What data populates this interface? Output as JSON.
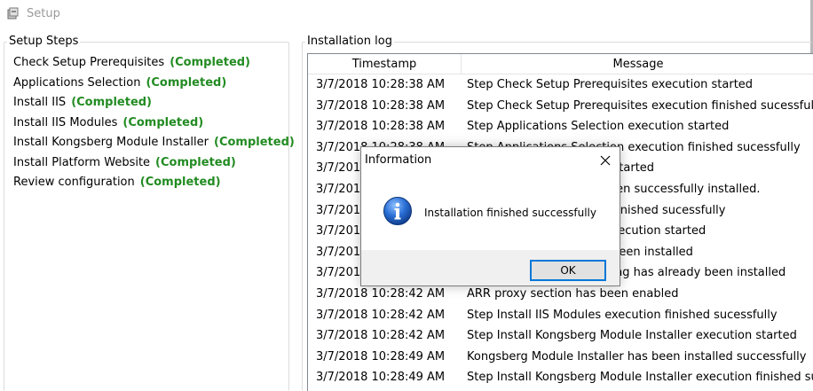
{
  "window": {
    "title": "Setup",
    "icon": "setup-app-icon"
  },
  "steps_panel": {
    "label": "Setup Steps",
    "items": [
      {
        "name": "Check Setup Prerequisites",
        "status": "(Completed)"
      },
      {
        "name": "Applications Selection",
        "status": "(Completed)"
      },
      {
        "name": "Install IIS",
        "status": "(Completed)"
      },
      {
        "name": "Install IIS Modules",
        "status": "(Completed)"
      },
      {
        "name": "Install Kongsberg Module Installer",
        "status": "(Completed)"
      },
      {
        "name": "Install Platform Website",
        "status": "(Completed)"
      },
      {
        "name": "Review configuration",
        "status": "(Completed)"
      }
    ],
    "status_color": "#228b22"
  },
  "log_panel": {
    "label": "Installation log",
    "columns": {
      "timestamp": "Timestamp",
      "message": "Message"
    },
    "rows": [
      {
        "timestamp": "3/7/2018 10:28:38 AM",
        "message": "Step Check Setup Prerequisites execution started"
      },
      {
        "timestamp": "3/7/2018 10:28:38 AM",
        "message": "Step Check Setup Prerequisites execution finished sucessfully"
      },
      {
        "timestamp": "3/7/2018 10:28:38 AM",
        "message": "Step Applications Selection execution started"
      },
      {
        "timestamp": "3/7/2018 10:28:38 AM",
        "message": "Step Applications Selection execution finished sucessfully"
      },
      {
        "timestamp": "3/7/2018 10:28:38 AM",
        "message": "Step Install IIS execution started"
      },
      {
        "timestamp": "3/7/2018 10:28:40 AM",
        "message": "All IIS components has been successfully installed."
      },
      {
        "timestamp": "3/7/2018 10:28:40 AM",
        "message": "Step Install IIS execution finished sucessfully"
      },
      {
        "timestamp": "3/7/2018 10:28:40 AM",
        "message": "Step Install IIS Modules execution started"
      },
      {
        "timestamp": "3/7/2018 10:28:41 AM",
        "message": "URL Rewrite module has been installed"
      },
      {
        "timestamp": "3/7/2018 10:28:41 AM",
        "message": "Application Request Routing has already been installed"
      },
      {
        "timestamp": "3/7/2018 10:28:42 AM",
        "message": "ARR proxy section has been enabled"
      },
      {
        "timestamp": "3/7/2018 10:28:42 AM",
        "message": "Step Install IIS Modules execution finished sucessfully"
      },
      {
        "timestamp": "3/7/2018 10:28:42 AM",
        "message": "Step Install Kongsberg Module Installer execution started"
      },
      {
        "timestamp": "3/7/2018 10:28:49 AM",
        "message": "Kongsberg Module Installer has been installed successfully"
      },
      {
        "timestamp": "3/7/2018 10:28:49 AM",
        "message": "Step Install Kongsberg Module Installer execution finished sucessfully"
      }
    ]
  },
  "dialog": {
    "title": "Information",
    "message": "Installation finished successfully",
    "ok_label": "OK",
    "icon": "info-icon",
    "accent": "#0078d7"
  }
}
